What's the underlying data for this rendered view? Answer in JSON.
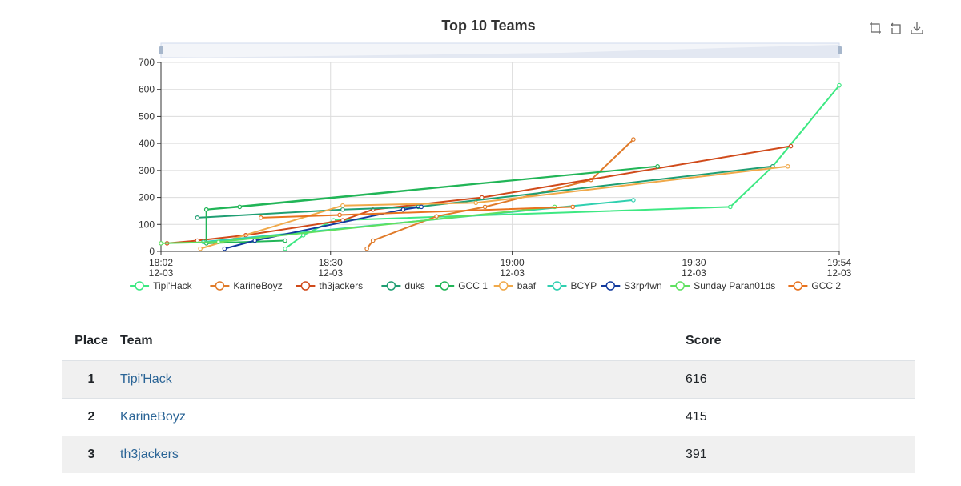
{
  "chart_data": {
    "type": "line",
    "title": "Top 10 Teams",
    "xlabel": "",
    "ylabel": "",
    "ylim": [
      0,
      700
    ],
    "yticks": [
      0,
      100,
      200,
      300,
      400,
      500,
      600,
      700
    ],
    "xlim": [
      "12-03 18:02",
      "12-03 19:54"
    ],
    "xticks": [
      {
        "time": "18:02",
        "date": "12-03",
        "min": 0
      },
      {
        "time": "18:30",
        "date": "12-03",
        "min": 28
      },
      {
        "time": "19:00",
        "date": "12-03",
        "min": 58
      },
      {
        "time": "19:30",
        "date": "12-03",
        "min": 88
      },
      {
        "time": "19:54",
        "date": "12-03",
        "min": 112
      }
    ],
    "grid": true,
    "legend_position": "bottom",
    "series": [
      {
        "name": "Tipi'Hack",
        "color": "#3de882",
        "points": [
          [
            20.5,
            10
          ],
          [
            23.5,
            60
          ],
          [
            28.5,
            115
          ],
          [
            94,
            165
          ],
          [
            101,
            315
          ],
          [
            112,
            615
          ]
        ]
      },
      {
        "name": "KarineBoyz",
        "color": "#e07b2a",
        "points": [
          [
            34,
            10
          ],
          [
            35,
            40
          ],
          [
            45.5,
            130
          ],
          [
            53.5,
            165
          ],
          [
            71,
            265
          ],
          [
            78,
            415
          ]
        ]
      },
      {
        "name": "th3jackers",
        "color": "#d04a1a",
        "points": [
          [
            1,
            30
          ],
          [
            6,
            40
          ],
          [
            14,
            60
          ],
          [
            30,
            115
          ],
          [
            35,
            155
          ],
          [
            53,
            200
          ],
          [
            104,
            390
          ]
        ]
      },
      {
        "name": "duks",
        "color": "#1f9e73",
        "points": [
          [
            6,
            125
          ],
          [
            30,
            155
          ],
          [
            42.5,
            165
          ],
          [
            101,
            315
          ]
        ]
      },
      {
        "name": "GCC 1",
        "color": "#21b557",
        "points": [
          [
            7.5,
            155
          ],
          [
            13,
            165
          ],
          [
            82,
            315
          ],
          [
            7.5,
            155
          ],
          [
            7.5,
            30
          ],
          [
            20.5,
            40
          ]
        ]
      },
      {
        "name": "baaf",
        "color": "#f0a94a",
        "points": [
          [
            6.5,
            10
          ],
          [
            30,
            170
          ],
          [
            52,
            180
          ],
          [
            103.5,
            315
          ]
        ]
      },
      {
        "name": "BCYP",
        "color": "#30d0b0",
        "points": [
          [
            7,
            35
          ],
          [
            78,
            190
          ]
        ]
      },
      {
        "name": "S3rp4wn",
        "color": "#123a9e",
        "points": [
          [
            10.5,
            10
          ],
          [
            15.5,
            40
          ],
          [
            40,
            155
          ],
          [
            43,
            165
          ]
        ]
      },
      {
        "name": "Sunday Paran01ds",
        "color": "#5fe060",
        "points": [
          [
            0,
            30
          ],
          [
            9.5,
            35
          ],
          [
            65,
            165
          ]
        ]
      },
      {
        "name": "GCC 2",
        "color": "#e8731f",
        "points": [
          [
            16.5,
            125
          ],
          [
            29.5,
            135
          ],
          [
            68,
            165
          ]
        ]
      }
    ]
  },
  "toolbox": {
    "zoom_icon": "zoom-icon",
    "reset_icon": "restore-icon",
    "save_icon": "download-icon"
  },
  "table": {
    "headers": {
      "place": "Place",
      "team": "Team",
      "score": "Score"
    },
    "rows": [
      {
        "place": "1",
        "team": "Tipi'Hack",
        "score": "616"
      },
      {
        "place": "2",
        "team": "KarineBoyz",
        "score": "415"
      },
      {
        "place": "3",
        "team": "th3jackers",
        "score": "391"
      }
    ]
  }
}
